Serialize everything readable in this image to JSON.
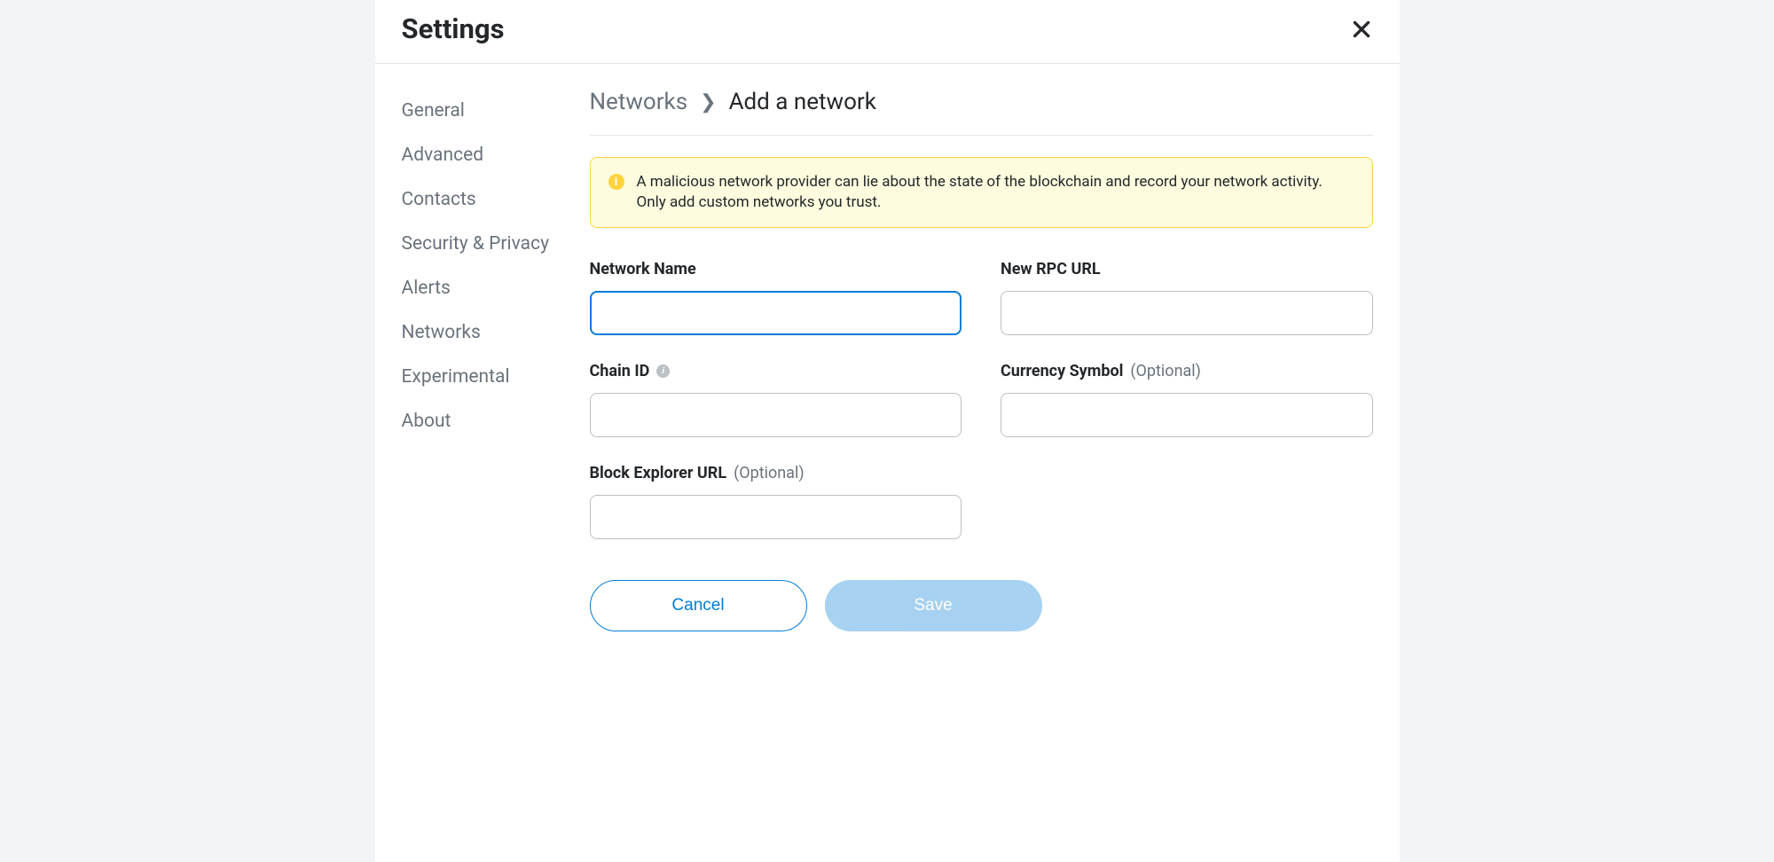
{
  "header": {
    "title": "Settings"
  },
  "sidebar": {
    "items": [
      {
        "label": "General"
      },
      {
        "label": "Advanced"
      },
      {
        "label": "Contacts"
      },
      {
        "label": "Security & Privacy"
      },
      {
        "label": "Alerts"
      },
      {
        "label": "Networks"
      },
      {
        "label": "Experimental"
      },
      {
        "label": "About"
      }
    ]
  },
  "breadcrumb": {
    "parent": "Networks",
    "current": "Add a network"
  },
  "warning": {
    "text": "A malicious network provider can lie about the state of the blockchain and record your network activity. Only add custom networks you trust."
  },
  "form": {
    "network_name": {
      "label": "Network Name",
      "value": ""
    },
    "rpc_url": {
      "label": "New RPC URL",
      "value": ""
    },
    "chain_id": {
      "label": "Chain ID",
      "value": ""
    },
    "currency": {
      "label": "Currency Symbol",
      "optional": "(Optional)",
      "value": ""
    },
    "explorer": {
      "label": "Block Explorer URL",
      "optional": "(Optional)",
      "value": ""
    }
  },
  "buttons": {
    "cancel": "Cancel",
    "save": "Save"
  }
}
